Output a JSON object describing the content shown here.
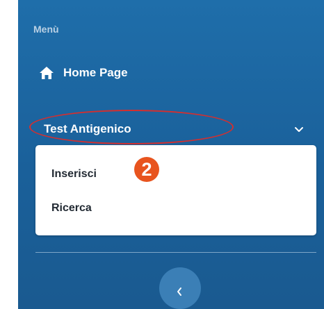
{
  "sidebar": {
    "heading": "Menù",
    "home": {
      "label": "Home Page",
      "icon": "home-icon"
    },
    "section": {
      "title": "Test Antigenico",
      "icon": "chevron-down-icon",
      "expanded": true,
      "items": [
        {
          "label": "Inserisci"
        },
        {
          "label": "Ricerca"
        }
      ]
    },
    "collapse_icon": "chevron-left-icon"
  },
  "annotation": {
    "step": "2",
    "badge_color": "#e8541e",
    "ellipse_color": "#d42f2f"
  },
  "colors": {
    "sidebar_bg": "#1f6eaa",
    "heading_text": "#b9d0e4",
    "submenu_bg": "#ffffff"
  }
}
